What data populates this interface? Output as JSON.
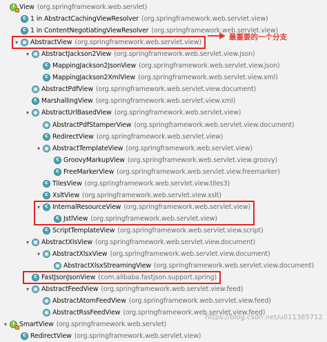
{
  "tree": [
    {
      "name": "View",
      "pkg": "(org.springframework.web.servlet)",
      "icon": "interface-icon",
      "level": 0,
      "toggle": "",
      "highlight": false
    },
    {
      "name": "1 in AbstractCachingViewResolver",
      "pkg": "(org.springframework.web.servlet.view)",
      "icon": "class-icon",
      "level": 1,
      "toggle": "",
      "highlight": false
    },
    {
      "name": "1 in ContentNegotiatingViewResolver",
      "pkg": "(org.springframework.web.servlet.view)",
      "icon": "class-icon",
      "level": 1,
      "toggle": "",
      "highlight": false
    },
    {
      "name": "AbstractView",
      "pkg": "(org.springframework.web.servlet.view)",
      "icon": "abstract-class-icon",
      "level": 1,
      "toggle": "expanded",
      "highlight": true
    },
    {
      "name": "AbstractJackson2View",
      "pkg": "(org.springframework.web.servlet.view.json)",
      "icon": "abstract-class-icon",
      "level": 2,
      "toggle": "expanded",
      "highlight": false
    },
    {
      "name": "MappingJackson2JsonView",
      "pkg": "(org.springframework.web.servlet.view.json)",
      "icon": "class-icon",
      "level": 3,
      "toggle": "",
      "highlight": false
    },
    {
      "name": "MappingJackson2XmlView",
      "pkg": "(org.springframework.web.servlet.view.xml)",
      "icon": "class-icon",
      "level": 3,
      "toggle": "",
      "highlight": false
    },
    {
      "name": "AbstractPdfView",
      "pkg": "(org.springframework.web.servlet.view.document)",
      "icon": "abstract-class-icon",
      "level": 2,
      "toggle": "",
      "highlight": false
    },
    {
      "name": "MarshallingView",
      "pkg": "(org.springframework.web.servlet.view.xml)",
      "icon": "class-icon",
      "level": 2,
      "toggle": "",
      "highlight": false
    },
    {
      "name": "AbstractUrlBasedView",
      "pkg": "(org.springframework.web.servlet.view)",
      "icon": "abstract-class-icon",
      "level": 2,
      "toggle": "expanded",
      "highlight": false
    },
    {
      "name": "AbstractPdfStamperView",
      "pkg": "(org.springframework.web.servlet.view.document)",
      "icon": "abstract-class-icon",
      "level": 3,
      "toggle": "",
      "highlight": false
    },
    {
      "name": "RedirectView",
      "pkg": "(org.springframework.web.servlet.view)",
      "icon": "class-icon",
      "level": 3,
      "toggle": "",
      "highlight": false
    },
    {
      "name": "AbstractTemplateView",
      "pkg": "(org.springframework.web.servlet.view)",
      "icon": "abstract-class-icon",
      "level": 3,
      "toggle": "expanded",
      "highlight": false
    },
    {
      "name": "GroovyMarkupView",
      "pkg": "(org.springframework.web.servlet.view.groovy)",
      "icon": "class-icon",
      "level": 4,
      "toggle": "",
      "highlight": false
    },
    {
      "name": "FreeMarkerView",
      "pkg": "(org.springframework.web.servlet.view.freemarker)",
      "icon": "class-icon",
      "level": 4,
      "toggle": "",
      "highlight": false
    },
    {
      "name": "TilesView",
      "pkg": "(org.springframework.web.servlet.view.tiles3)",
      "icon": "class-icon",
      "level": 3,
      "toggle": "",
      "highlight": false
    },
    {
      "name": "XsltView",
      "pkg": "(org.springframework.web.servlet.view.xslt)",
      "icon": "class-icon",
      "level": 3,
      "toggle": "",
      "highlight": false
    },
    {
      "name": "InternalResourceView",
      "pkg": "(org.springframework.web.servlet.view)",
      "icon": "class-icon",
      "level": 3,
      "toggle": "expanded",
      "highlight": true
    },
    {
      "name": "JstlView",
      "pkg": "(org.springframework.web.servlet.view)",
      "icon": "class-icon",
      "level": 4,
      "toggle": "",
      "highlight": true
    },
    {
      "name": "ScriptTemplateView",
      "pkg": "(org.springframework.web.servlet.view.script)",
      "icon": "class-icon",
      "level": 3,
      "toggle": "",
      "highlight": false
    },
    {
      "name": "AbstractXlsView",
      "pkg": "(org.springframework.web.servlet.view.document)",
      "icon": "abstract-class-icon",
      "level": 2,
      "toggle": "expanded",
      "highlight": false
    },
    {
      "name": "AbstractXlsxView",
      "pkg": "(org.springframework.web.servlet.view.document)",
      "icon": "abstract-class-icon",
      "level": 3,
      "toggle": "expanded",
      "highlight": false
    },
    {
      "name": "AbstractXlsxStreamingView",
      "pkg": "(org.springframework.web.servlet.view.document)",
      "icon": "abstract-class-icon",
      "level": 4,
      "toggle": "",
      "highlight": false
    },
    {
      "name": "FastJsonJsonView",
      "pkg": "(com.alibaba.fastjson.support.spring)",
      "icon": "class-icon",
      "level": 2,
      "toggle": "",
      "highlight": true
    },
    {
      "name": "AbstractFeedView",
      "pkg": "(org.springframework.web.servlet.view.feed)",
      "icon": "abstract-class-icon",
      "level": 2,
      "toggle": "expanded",
      "highlight": false
    },
    {
      "name": "AbstractAtomFeedView",
      "pkg": "(org.springframework.web.servlet.view.feed)",
      "icon": "abstract-class-icon",
      "level": 3,
      "toggle": "",
      "highlight": false
    },
    {
      "name": "AbstractRssFeedView",
      "pkg": "(org.springframework.web.servlet.view.feed)",
      "icon": "abstract-class-icon",
      "level": 3,
      "toggle": "",
      "highlight": false
    },
    {
      "name": "SmartView",
      "pkg": "(org.springframework.web.servlet)",
      "icon": "interface-icon",
      "level": 0,
      "toggle": "expanded",
      "highlight": false
    },
    {
      "name": "RedirectView",
      "pkg": "(org.springframework.web.servlet.view)",
      "icon": "class-icon",
      "level": 1,
      "toggle": "",
      "highlight": false
    }
  ],
  "callout": {
    "text": "最重要的一个分支",
    "color": "#e53935"
  },
  "highlight_color": "#e22222",
  "watermark": "https://blog.csdn.net/u011385712"
}
